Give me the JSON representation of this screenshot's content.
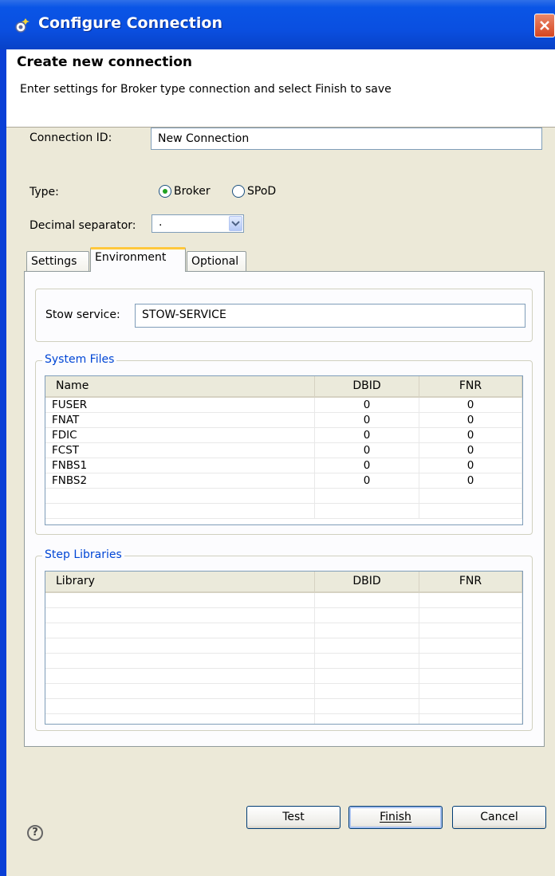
{
  "window": {
    "title": "Configure Connection",
    "colors": {
      "titlebar": "#0a4fe0",
      "close": "#d6451f",
      "group_title": "#0046d5"
    }
  },
  "header": {
    "title": "Create new connection",
    "description": "Enter settings for Broker type connection and select Finish to save"
  },
  "form": {
    "connection_id_label": "Connection ID:",
    "connection_id_value": "New Connection",
    "type_label": "Type:",
    "type_options": [
      {
        "label": "Broker",
        "selected": true
      },
      {
        "label": "SPoD",
        "selected": false
      }
    ],
    "decimal_label": "Decimal separator:",
    "decimal_value": "."
  },
  "tabs": [
    {
      "label": "Settings",
      "active": false
    },
    {
      "label": "Environment",
      "active": true
    },
    {
      "label": "Optional",
      "active": false
    }
  ],
  "environment": {
    "stow_label": "Stow service:",
    "stow_value": "STOW-SERVICE",
    "system_files": {
      "title": "System Files",
      "columns": [
        "Name",
        "DBID",
        "FNR"
      ],
      "rows": [
        [
          "FUSER",
          "0",
          "0"
        ],
        [
          "FNAT",
          "0",
          "0"
        ],
        [
          "FDIC",
          "0",
          "0"
        ],
        [
          "FCST",
          "0",
          "0"
        ],
        [
          "FNBS1",
          "0",
          "0"
        ],
        [
          "FNBS2",
          "0",
          "0"
        ]
      ]
    },
    "step_libraries": {
      "title": "Step Libraries",
      "columns": [
        "Library",
        "DBID",
        "FNR"
      ],
      "rows": []
    }
  },
  "footer": {
    "help_icon": "?",
    "test_label": "Test",
    "finish_label": "Finish",
    "cancel_label": "Cancel"
  }
}
